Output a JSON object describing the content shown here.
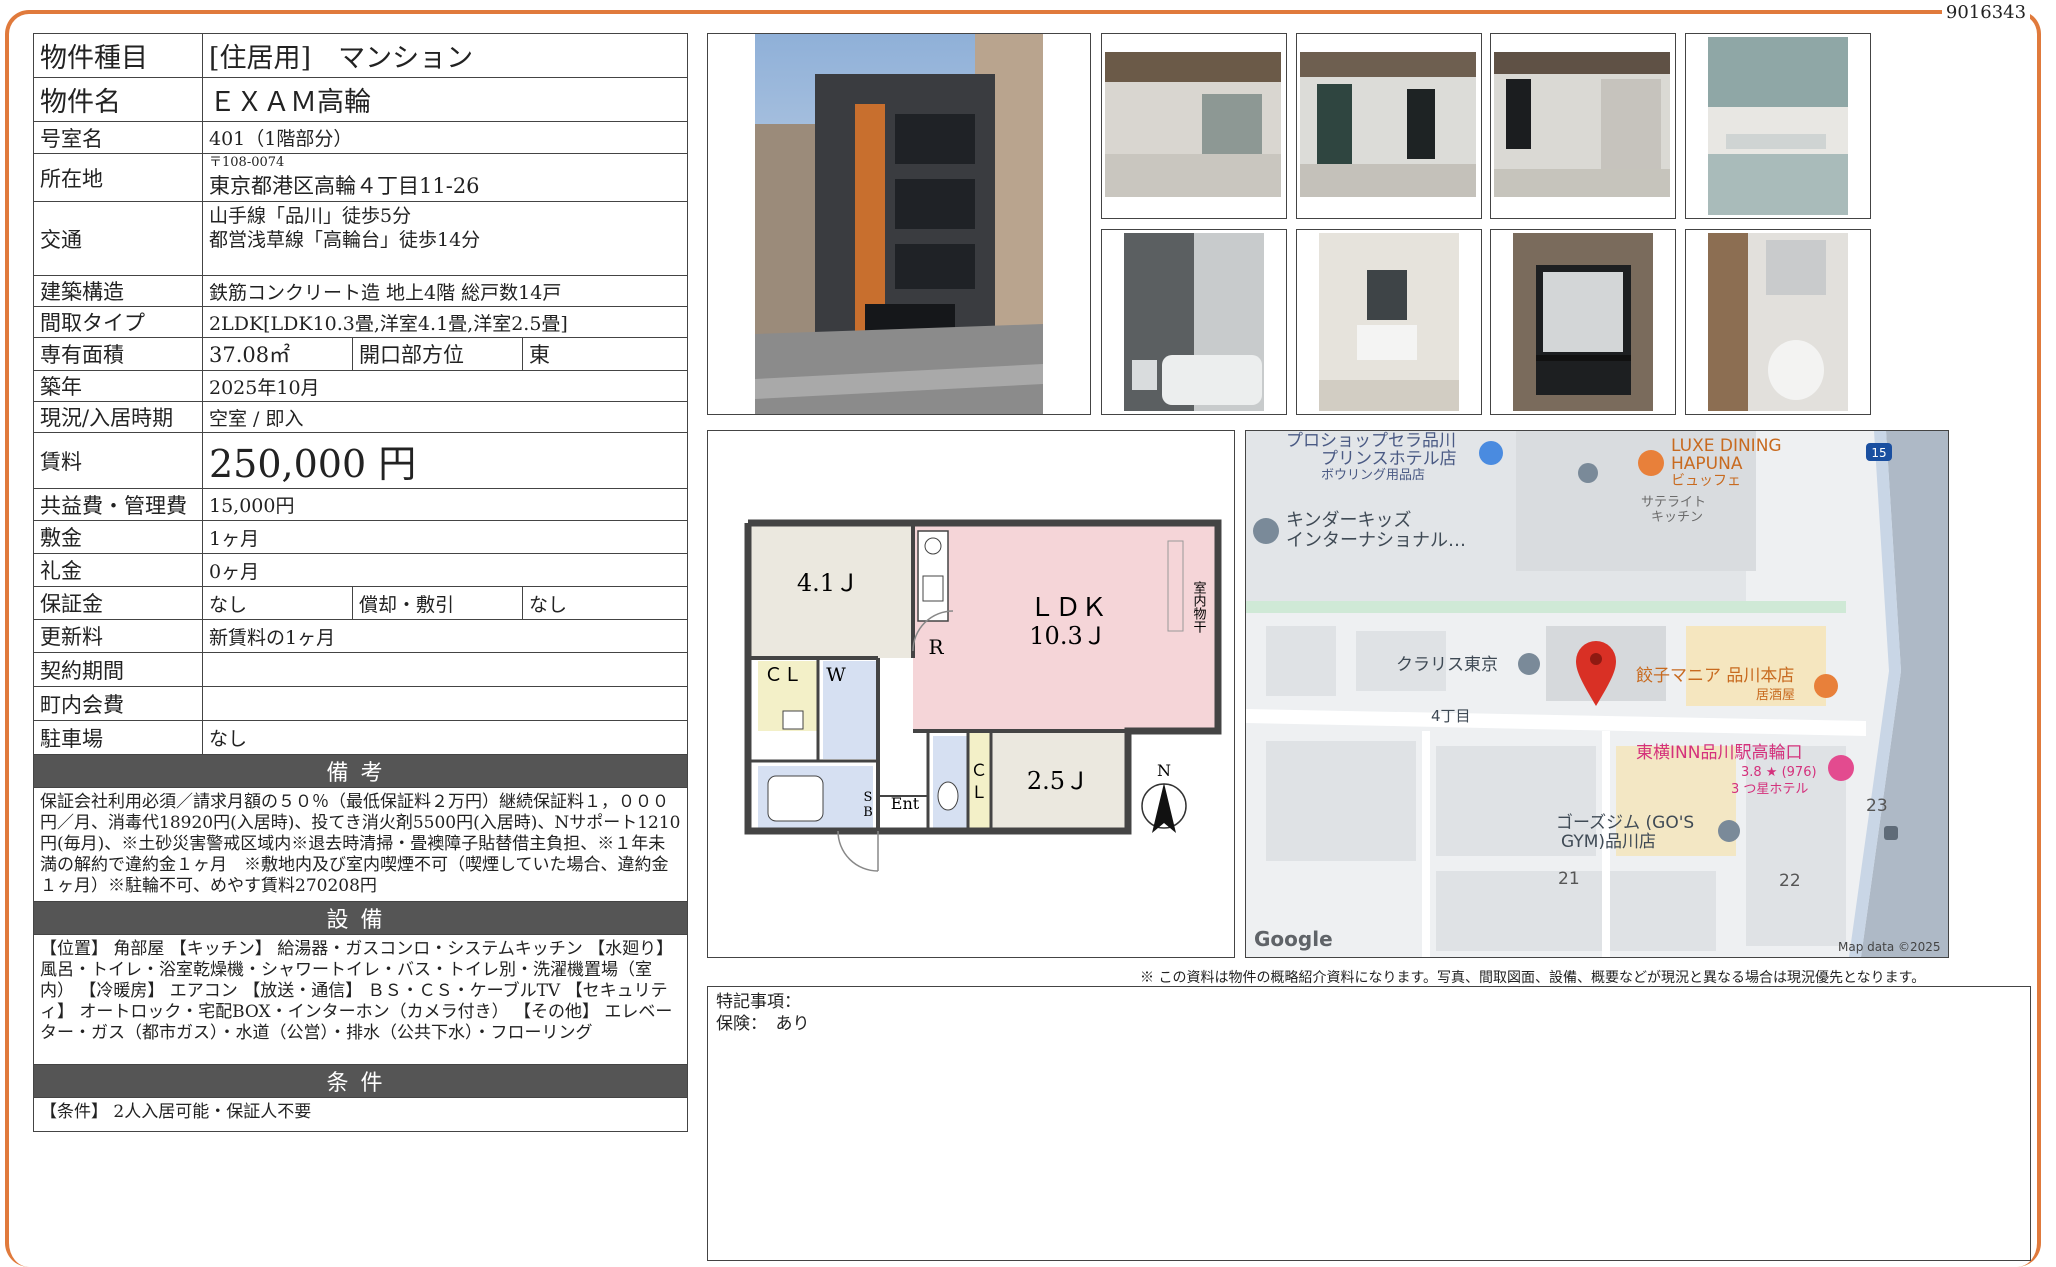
{
  "doc_id": "9016343",
  "spec": {
    "type": {
      "label": "物件種目",
      "value": "[住居用]　マンション"
    },
    "name": {
      "label": "物件名",
      "value": "ＥＸＡＭ高輪"
    },
    "room": {
      "label": "号室名",
      "value": "401（1階部分）"
    },
    "address": {
      "label": "所在地",
      "postal": "〒108-0074",
      "value": "東京都港区高輪４丁目11-26"
    },
    "access": {
      "label": "交通",
      "line1": "山手線「品川」徒歩5分",
      "line2": "都営浅草線「高輪台」徒歩14分"
    },
    "structure": {
      "label": "建築構造",
      "value": "鉄筋コンクリート造 地上4階 総戸数14戸"
    },
    "layout": {
      "label": "間取タイプ",
      "value": "2LDK[LDK10.3畳,洋室4.1畳,洋室2.5畳]"
    },
    "area": {
      "label": "専有面積",
      "value": "37.08㎡",
      "dir_label": "開口部方位",
      "dir_value": "東"
    },
    "built": {
      "label": "築年",
      "value": "2025年10月"
    },
    "status": {
      "label": "現況/入居時期",
      "value": "空室 / 即入"
    },
    "rent": {
      "label": "賃料",
      "value": "250,000 円"
    },
    "fee": {
      "label": "共益費・管理費",
      "value": "15,000円"
    },
    "deposit": {
      "label": "敷金",
      "value": "1ヶ月"
    },
    "key_money": {
      "label": "礼金",
      "value": "0ヶ月"
    },
    "guarantee": {
      "label": "保証金",
      "value": "なし",
      "amort_label": "償却・敷引",
      "amort_value": "なし"
    },
    "renewal": {
      "label": "更新料",
      "value": "新賃料の1ヶ月"
    },
    "contract": {
      "label": "契約期間",
      "value": ""
    },
    "association": {
      "label": "町内会費",
      "value": ""
    },
    "parking": {
      "label": "駐車場",
      "value": "なし"
    },
    "remarks_head": "備考",
    "remarks": "保証会社利用必須／請求月額の５０％（最低保証料２万円）継続保証料１，０００円／月、消毒代18920円(入居時)、投てき消火剤5500円(入居時)、Nサポート1210円(毎月)、※土砂災害警戒区域内※退去時清掃・畳襖障子貼替借主負担、※１年未満の解約で違約金１ヶ月　※敷地内及び室内喫煙不可（喫煙していた場合、違約金１ヶ月）※駐輪不可、めやす賃料270208円",
    "equip_head": "設備",
    "equipment": "【位置】 角部屋 【キッチン】 給湯器・ガスコンロ・システムキッチン 【水廻り】 風呂・トイレ・浴室乾燥機・シャワートイレ・バス・トイレ別・洗濯機置場（室内） 【冷暖房】 エアコン 【放送・通信】 ＢＳ・ＣＳ・ケーブルTV 【セキュリティ】 オートロック・宅配BOX・インターホン（カメラ付き） 【その他】 エレベーター・ガス（都市ガス）・水道（公営）・排水（公共下水）・フローリング",
    "cond_head": "条件",
    "conditions": "【条件】 2人入居可能・保証人不要"
  },
  "floorplan": {
    "room1": "4.1Ｊ",
    "ldk": "ＬＤＫ",
    "ldk_size": "10.3Ｊ",
    "room2": "2.5Ｊ",
    "laundry": "室内物干",
    "r": "R",
    "cl": "ＣＬ",
    "w": "W",
    "cl2": "Ｃ",
    "cl2b": "Ｌ",
    "sb": "S",
    "sb2": "B",
    "ent": "Ent",
    "north": "N"
  },
  "map": {
    "poi1a": "プロショップセラ品川",
    "poi1b": "プリンスホテル店",
    "poi1c": "ボウリング用品店",
    "poi2a": "LUXE DINING",
    "poi2b": "HAPUNA",
    "poi2c": "ビュッフェ",
    "poi3a": "サテライト",
    "poi3b": "キッチン",
    "poi4a": "キンダーキッズ",
    "poi4b": "インターナショナル…",
    "poi5": "クラリス東京",
    "poi6a": "餃子マニア 品川本店",
    "poi6b": "居酒屋",
    "street": "4丁目",
    "poi7a": "東横INN品川駅高輪口",
    "poi7b": "3.8 ★ (976)",
    "poi7c": "3 つ星ホテル",
    "poi8a": "ゴーズジム (GO'S",
    "poi8b": "GYM)品川店",
    "n21": "21",
    "n22": "22",
    "n23": "23",
    "route": "15",
    "google": "Google",
    "mapdata": "Map data ©2025"
  },
  "disclaimer": "※ この資料は物件の概略紹介資料になります。写真、間取図面、設備、概要などが現況と異なる場合は現況優先となります。",
  "special": {
    "line1": "特記事項：",
    "line2": "保険：　あり"
  },
  "colors": {
    "frame": "#e07a3c",
    "section_head": "#555555",
    "ldk_fill": "#f5d5d8",
    "room_fill": "#ebe8df",
    "cl_fill": "#f3f0c8",
    "bath_fill": "#d6e0f2",
    "pin": "#d93025",
    "poi_orange": "#e8803a",
    "route_blue": "#1a4fa0"
  }
}
